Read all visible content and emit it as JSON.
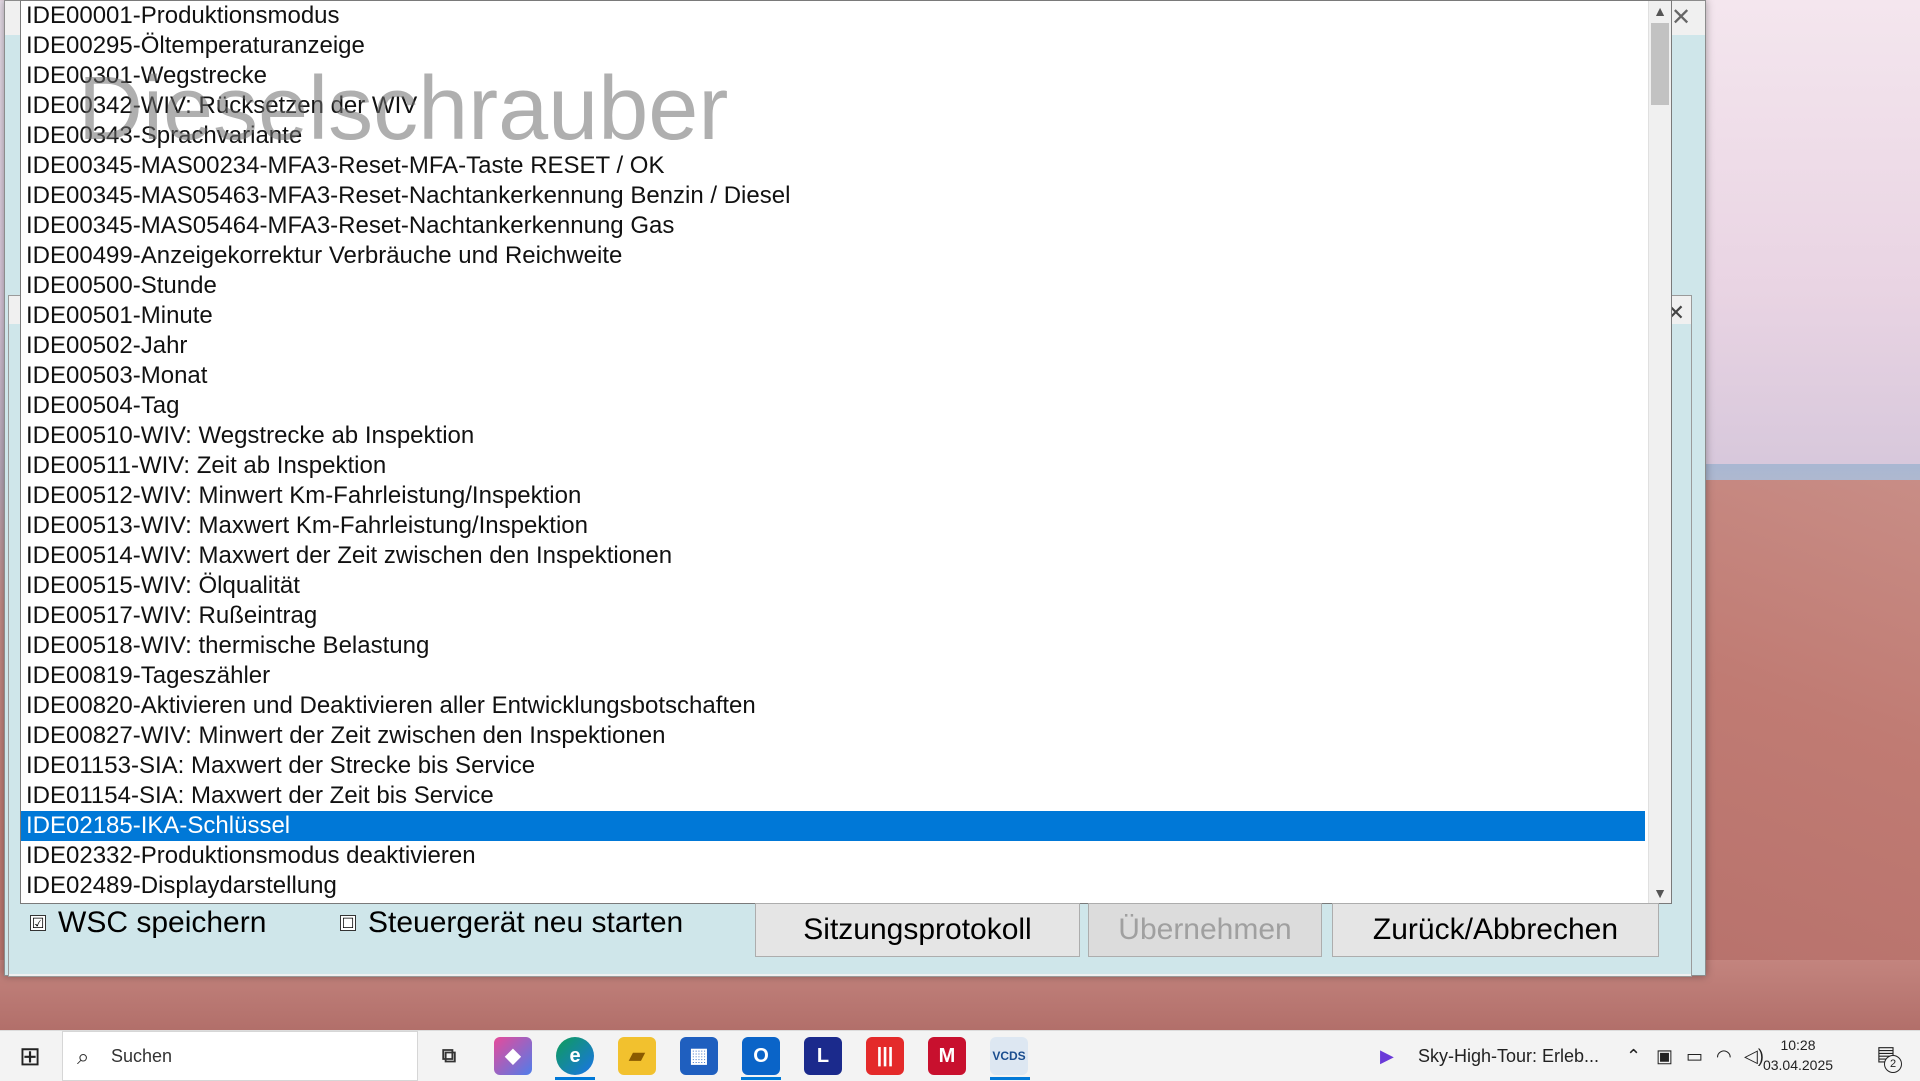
{
  "dropdown": {
    "items": [
      "IDE00001-Produktionsmodus",
      "IDE00295-Öltemperaturanzeige",
      "IDE00301-Wegstrecke",
      "IDE00342-WIV: Rücksetzen der WIV",
      "IDE00343-Sprachvariante",
      "IDE00345-MAS00234-MFA3-Reset-MFA-Taste RESET / OK",
      "IDE00345-MAS05463-MFA3-Reset-Nachtankerkennung Benzin / Diesel",
      "IDE00345-MAS05464-MFA3-Reset-Nachtankerkennung Gas",
      "IDE00499-Anzeigekorrektur Verbräuche und Reichweite",
      "IDE00500-Stunde",
      "IDE00501-Minute",
      "IDE00502-Jahr",
      "IDE00503-Monat",
      "IDE00504-Tag",
      "IDE00510-WIV: Wegstrecke ab Inspektion",
      "IDE00511-WIV: Zeit ab Inspektion",
      "IDE00512-WIV: Minwert Km-Fahrleistung/Inspektion",
      "IDE00513-WIV: Maxwert Km-Fahrleistung/Inspektion",
      "IDE00514-WIV: Maxwert der Zeit zwischen den Inspektionen",
      "IDE00515-WIV: Ölqualität",
      "IDE00517-WIV: Rußeintrag",
      "IDE00518-WIV: thermische Belastung",
      "IDE00819-Tageszähler",
      "IDE00820-Aktivieren und Deaktivieren aller Entwicklungsbotschaften",
      "IDE00827-WIV: Minwert der Zeit zwischen den Inspektionen",
      "IDE01153-SIA: Maxwert der Strecke bis Service",
      "IDE01154-SIA: Maxwert der Zeit bis Service",
      "IDE02185-IKA-Schlüssel",
      "IDE02332-Produktionsmodus deaktivieren",
      "IDE02489-Displaydarstellung"
    ],
    "selected_index": 27
  },
  "watermark": "Dieselschrauber",
  "options": {
    "wsc_label": "WSC speichern",
    "wsc_checked": "☑",
    "restart_label": "Steuergerät neu starten",
    "restart_checked": "☐"
  },
  "buttons": {
    "session_log": "Sitzungsprotokoll",
    "apply": "Übernehmen",
    "back_cancel": "Zurück/Abbrechen"
  },
  "taskbar": {
    "search_placeholder": "Suchen",
    "media_title": "Sky-High-Tour: Erleb...",
    "time": "10:28",
    "date": "03.04.2025",
    "notification_count": "2"
  },
  "colors": {
    "selection": "#0078d7",
    "window_body": "#cfe6ea"
  }
}
